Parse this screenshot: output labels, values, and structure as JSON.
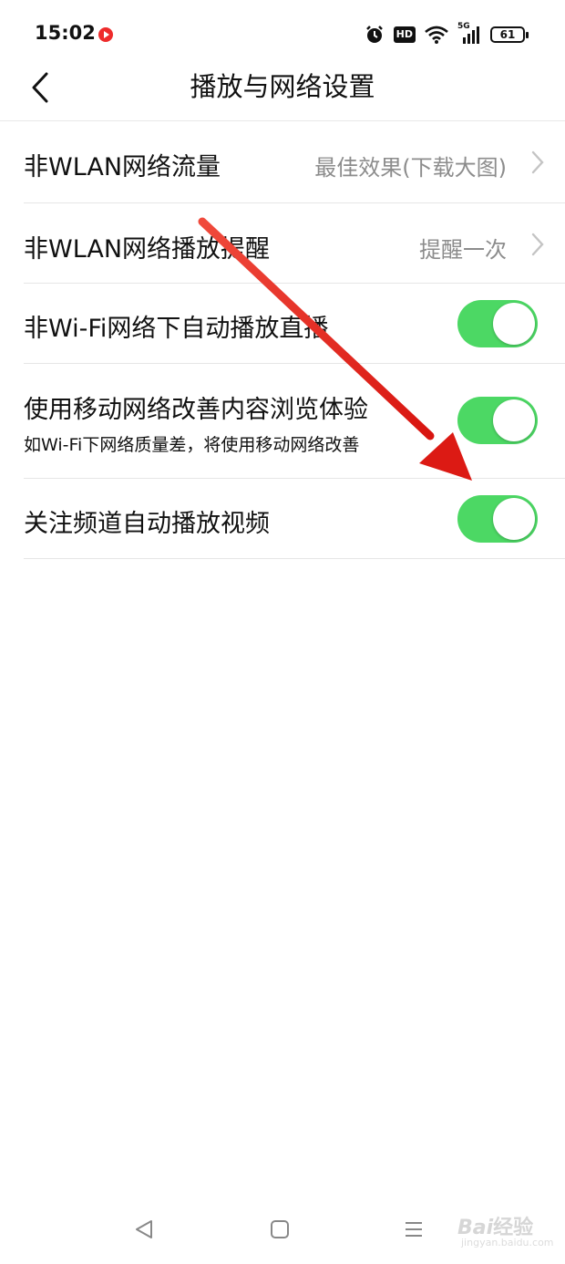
{
  "status_bar": {
    "time": "15:02",
    "hd_label": "HD",
    "network_label": "5G",
    "battery": "61",
    "icons": [
      "app-notification-icon",
      "alarm-icon",
      "hd-icon",
      "wifi-icon",
      "signal-icon",
      "battery-icon"
    ]
  },
  "header": {
    "title": "播放与网络设置",
    "back_icon": "back-chevron-icon"
  },
  "settings": [
    {
      "label": "非WLAN网络流量",
      "value": "最佳效果(下载大图)",
      "type": "link"
    },
    {
      "label": "非WLAN网络播放提醒",
      "value": "提醒一次",
      "type": "link"
    },
    {
      "label": "非Wi-Fi网络下自动播放直播",
      "type": "toggle",
      "on": true
    },
    {
      "label": "使用移动网络改善内容浏览体验",
      "sublabel": "如Wi-Fi下网络质量差，将使用移动网络改善",
      "type": "toggle",
      "on": true
    },
    {
      "label": "关注频道自动播放视频",
      "type": "toggle",
      "on": true
    }
  ],
  "colors": {
    "toggle_on": "#4cd864",
    "annotation_arrow": "#e8201c",
    "secondary_text": "#8c8c8c"
  },
  "navbar": {
    "icons": [
      "back-triangle-icon",
      "home-square-icon",
      "menu-lines-icon"
    ]
  },
  "watermark": {
    "brand": "Bai",
    "brand_cn": "经验",
    "url": "jingyan.baidu.com"
  }
}
